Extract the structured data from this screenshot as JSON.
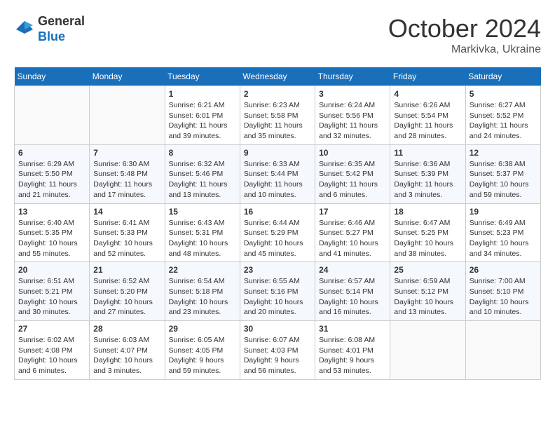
{
  "header": {
    "logo_line1": "General",
    "logo_line2": "Blue",
    "month_title": "October 2024",
    "location": "Markivka, Ukraine"
  },
  "weekdays": [
    "Sunday",
    "Monday",
    "Tuesday",
    "Wednesday",
    "Thursday",
    "Friday",
    "Saturday"
  ],
  "weeks": [
    [
      {
        "day": "",
        "info": ""
      },
      {
        "day": "",
        "info": ""
      },
      {
        "day": "1",
        "info": "Sunrise: 6:21 AM\nSunset: 6:01 PM\nDaylight: 11 hours and 39 minutes."
      },
      {
        "day": "2",
        "info": "Sunrise: 6:23 AM\nSunset: 5:58 PM\nDaylight: 11 hours and 35 minutes."
      },
      {
        "day": "3",
        "info": "Sunrise: 6:24 AM\nSunset: 5:56 PM\nDaylight: 11 hours and 32 minutes."
      },
      {
        "day": "4",
        "info": "Sunrise: 6:26 AM\nSunset: 5:54 PM\nDaylight: 11 hours and 28 minutes."
      },
      {
        "day": "5",
        "info": "Sunrise: 6:27 AM\nSunset: 5:52 PM\nDaylight: 11 hours and 24 minutes."
      }
    ],
    [
      {
        "day": "6",
        "info": "Sunrise: 6:29 AM\nSunset: 5:50 PM\nDaylight: 11 hours and 21 minutes."
      },
      {
        "day": "7",
        "info": "Sunrise: 6:30 AM\nSunset: 5:48 PM\nDaylight: 11 hours and 17 minutes."
      },
      {
        "day": "8",
        "info": "Sunrise: 6:32 AM\nSunset: 5:46 PM\nDaylight: 11 hours and 13 minutes."
      },
      {
        "day": "9",
        "info": "Sunrise: 6:33 AM\nSunset: 5:44 PM\nDaylight: 11 hours and 10 minutes."
      },
      {
        "day": "10",
        "info": "Sunrise: 6:35 AM\nSunset: 5:42 PM\nDaylight: 11 hours and 6 minutes."
      },
      {
        "day": "11",
        "info": "Sunrise: 6:36 AM\nSunset: 5:39 PM\nDaylight: 11 hours and 3 minutes."
      },
      {
        "day": "12",
        "info": "Sunrise: 6:38 AM\nSunset: 5:37 PM\nDaylight: 10 hours and 59 minutes."
      }
    ],
    [
      {
        "day": "13",
        "info": "Sunrise: 6:40 AM\nSunset: 5:35 PM\nDaylight: 10 hours and 55 minutes."
      },
      {
        "day": "14",
        "info": "Sunrise: 6:41 AM\nSunset: 5:33 PM\nDaylight: 10 hours and 52 minutes."
      },
      {
        "day": "15",
        "info": "Sunrise: 6:43 AM\nSunset: 5:31 PM\nDaylight: 10 hours and 48 minutes."
      },
      {
        "day": "16",
        "info": "Sunrise: 6:44 AM\nSunset: 5:29 PM\nDaylight: 10 hours and 45 minutes."
      },
      {
        "day": "17",
        "info": "Sunrise: 6:46 AM\nSunset: 5:27 PM\nDaylight: 10 hours and 41 minutes."
      },
      {
        "day": "18",
        "info": "Sunrise: 6:47 AM\nSunset: 5:25 PM\nDaylight: 10 hours and 38 minutes."
      },
      {
        "day": "19",
        "info": "Sunrise: 6:49 AM\nSunset: 5:23 PM\nDaylight: 10 hours and 34 minutes."
      }
    ],
    [
      {
        "day": "20",
        "info": "Sunrise: 6:51 AM\nSunset: 5:21 PM\nDaylight: 10 hours and 30 minutes."
      },
      {
        "day": "21",
        "info": "Sunrise: 6:52 AM\nSunset: 5:20 PM\nDaylight: 10 hours and 27 minutes."
      },
      {
        "day": "22",
        "info": "Sunrise: 6:54 AM\nSunset: 5:18 PM\nDaylight: 10 hours and 23 minutes."
      },
      {
        "day": "23",
        "info": "Sunrise: 6:55 AM\nSunset: 5:16 PM\nDaylight: 10 hours and 20 minutes."
      },
      {
        "day": "24",
        "info": "Sunrise: 6:57 AM\nSunset: 5:14 PM\nDaylight: 10 hours and 16 minutes."
      },
      {
        "day": "25",
        "info": "Sunrise: 6:59 AM\nSunset: 5:12 PM\nDaylight: 10 hours and 13 minutes."
      },
      {
        "day": "26",
        "info": "Sunrise: 7:00 AM\nSunset: 5:10 PM\nDaylight: 10 hours and 10 minutes."
      }
    ],
    [
      {
        "day": "27",
        "info": "Sunrise: 6:02 AM\nSunset: 4:08 PM\nDaylight: 10 hours and 6 minutes."
      },
      {
        "day": "28",
        "info": "Sunrise: 6:03 AM\nSunset: 4:07 PM\nDaylight: 10 hours and 3 minutes."
      },
      {
        "day": "29",
        "info": "Sunrise: 6:05 AM\nSunset: 4:05 PM\nDaylight: 9 hours and 59 minutes."
      },
      {
        "day": "30",
        "info": "Sunrise: 6:07 AM\nSunset: 4:03 PM\nDaylight: 9 hours and 56 minutes."
      },
      {
        "day": "31",
        "info": "Sunrise: 6:08 AM\nSunset: 4:01 PM\nDaylight: 9 hours and 53 minutes."
      },
      {
        "day": "",
        "info": ""
      },
      {
        "day": "",
        "info": ""
      }
    ]
  ]
}
